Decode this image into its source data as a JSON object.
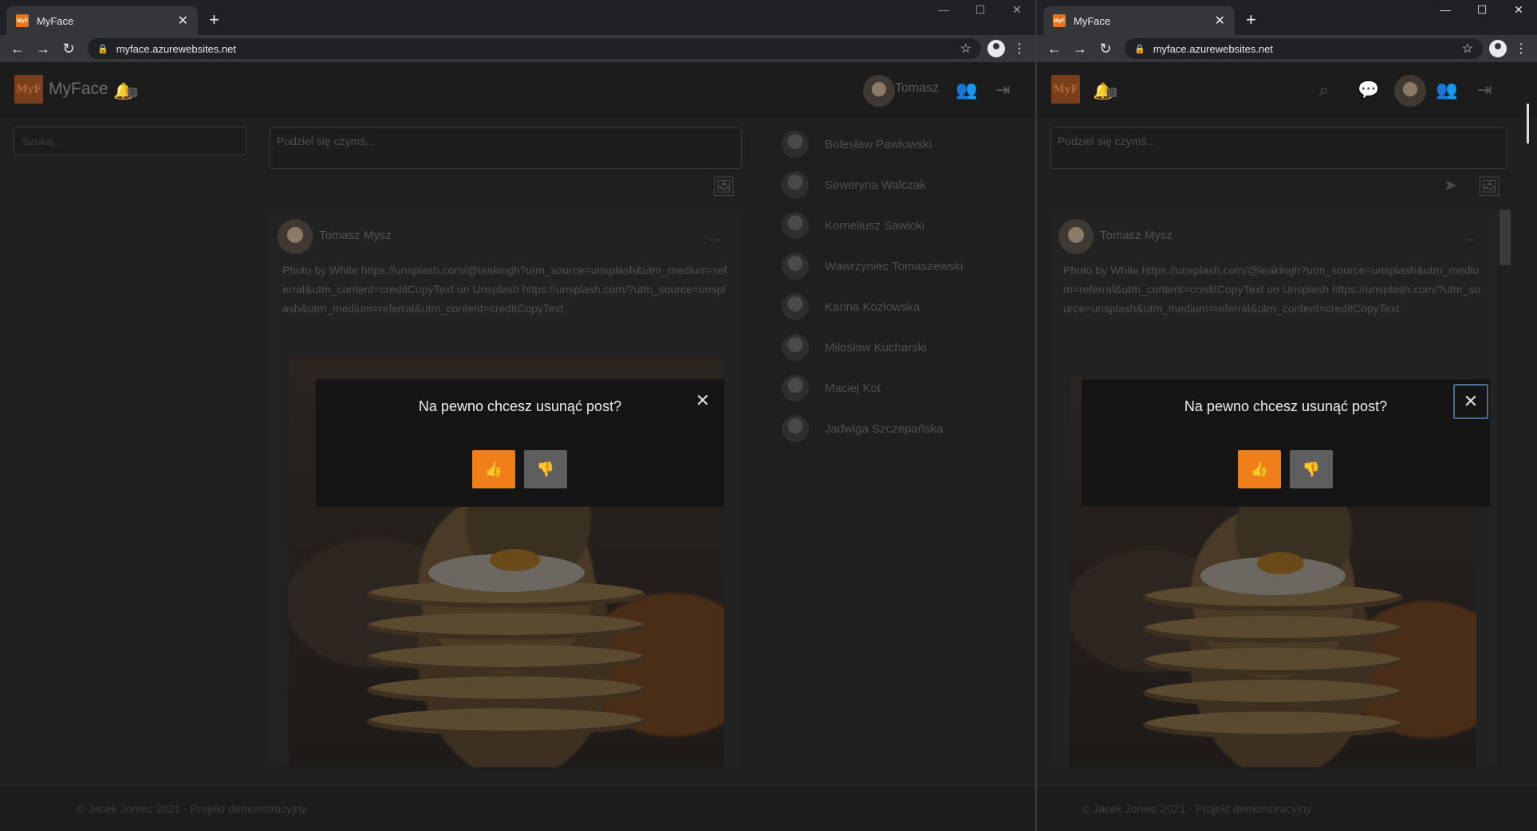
{
  "tab": {
    "title": "MyFace",
    "favicon_text": "MyF"
  },
  "browser": {
    "url": "myface.azurewebsites.net"
  },
  "app": {
    "logo": "MyF",
    "brand": "MyFace",
    "notifications": "0"
  },
  "user": {
    "name": "Tomasz"
  },
  "search": {
    "placeholder": "Szukaj..."
  },
  "composer": {
    "placeholder": "Podziel się czymś..."
  },
  "post": {
    "author": "Tomasz Mysz",
    "menu": "...",
    "text": "Photo by White https://unsplash.com/@leakingh?utm_source=unsplash&utm_medium=referral&utm_content=creditCopyText on Unsplash https://unsplash.com/?utm_source=unsplash&utm_medium=referral&utm_content=creditCopyText"
  },
  "modal": {
    "question": "Na pewno chcesz usunąć post?"
  },
  "friends": [
    {
      "name": "Bolesław Pawłowski"
    },
    {
      "name": "Seweryna Walczak"
    },
    {
      "name": "Korneliusz Sawicki"
    },
    {
      "name": "Wawrzyniec Tomaszewski"
    },
    {
      "name": "Karina Kozłowska"
    },
    {
      "name": "Miłosław Kucharski"
    },
    {
      "name": "Maciej Kot"
    },
    {
      "name": "Jadwiga Szczepańska"
    }
  ],
  "footer": {
    "text": "© Jacek Joniec 2021 - Projekt demonstracyjny"
  },
  "colors": {
    "accent": "#f07f1a",
    "reject": "#5e5e5e",
    "modal_bg": "#151515"
  },
  "icons": [
    "bell-icon",
    "users-icon",
    "logout-icon",
    "image-icon",
    "send-icon",
    "search-icon",
    "chat-icon",
    "thumbs-up-icon",
    "thumbs-down-icon",
    "close-icon"
  ]
}
